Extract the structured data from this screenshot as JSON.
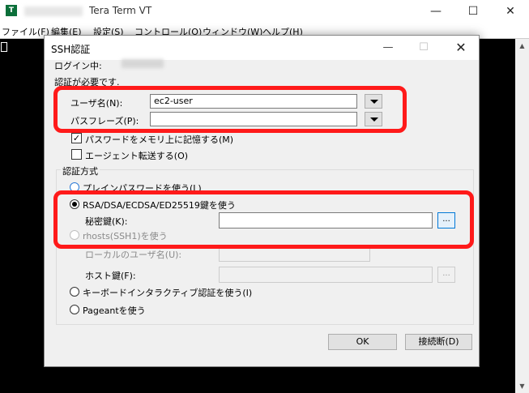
{
  "window": {
    "app_icon_glyph": "T",
    "title": "Tera Term VT",
    "minimize_glyph": "—",
    "maximize_glyph": "☐",
    "close_glyph": "✕"
  },
  "menu": [
    "ファイル(F)",
    "編集(E)",
    "設定(S)",
    "コントロール(O)",
    "ウィンドウ(W)",
    "ヘルプ(H)"
  ],
  "scrollbar": {
    "up_glyph": "▲",
    "down_glyph": "▼"
  },
  "dialog": {
    "title": "SSH認証",
    "minimize_glyph": "—",
    "maximize_glyph": "☐",
    "close_glyph": "✕",
    "login_label": "ログイン中:",
    "auth_required": "認証が必要です.",
    "username_label": "ユーザ名(N):",
    "username_value": "ec2-user",
    "passphrase_label": "パスフレーズ(P):",
    "passphrase_value": "",
    "remember_password": {
      "label": "パスワードをメモリ上に記憶する(M)",
      "checked": true,
      "check_glyph": "✓"
    },
    "agent_forwarding": {
      "label": "エージェント転送する(O)",
      "checked": false
    },
    "auth_method_title": "認証方式",
    "methods": {
      "plain_password": "プレインパスワードを使う(L)",
      "rsa_key": "RSA/DSA/ECDSA/ED25519鍵を使う",
      "private_key_label": "秘密鍵(K):",
      "private_key_value": "",
      "browse_glyph": "...",
      "rhosts": "rhosts(SSH1)を使う",
      "local_user_label": "ローカルのユーザ名(U):",
      "host_key_label": "ホスト鍵(F):",
      "keyboard_interactive": "キーボードインタラクティブ認証を使う(I)",
      "pageant": "Pageantを使う"
    },
    "selected_method": "rsa_key",
    "ok_label": "OK",
    "disconnect_label": "接続断(D)"
  },
  "colors": {
    "highlight": "#ff1a1a",
    "terminal_bg": "#000000",
    "dialog_bg": "#f0f0f0",
    "accent": "#0078d7"
  }
}
